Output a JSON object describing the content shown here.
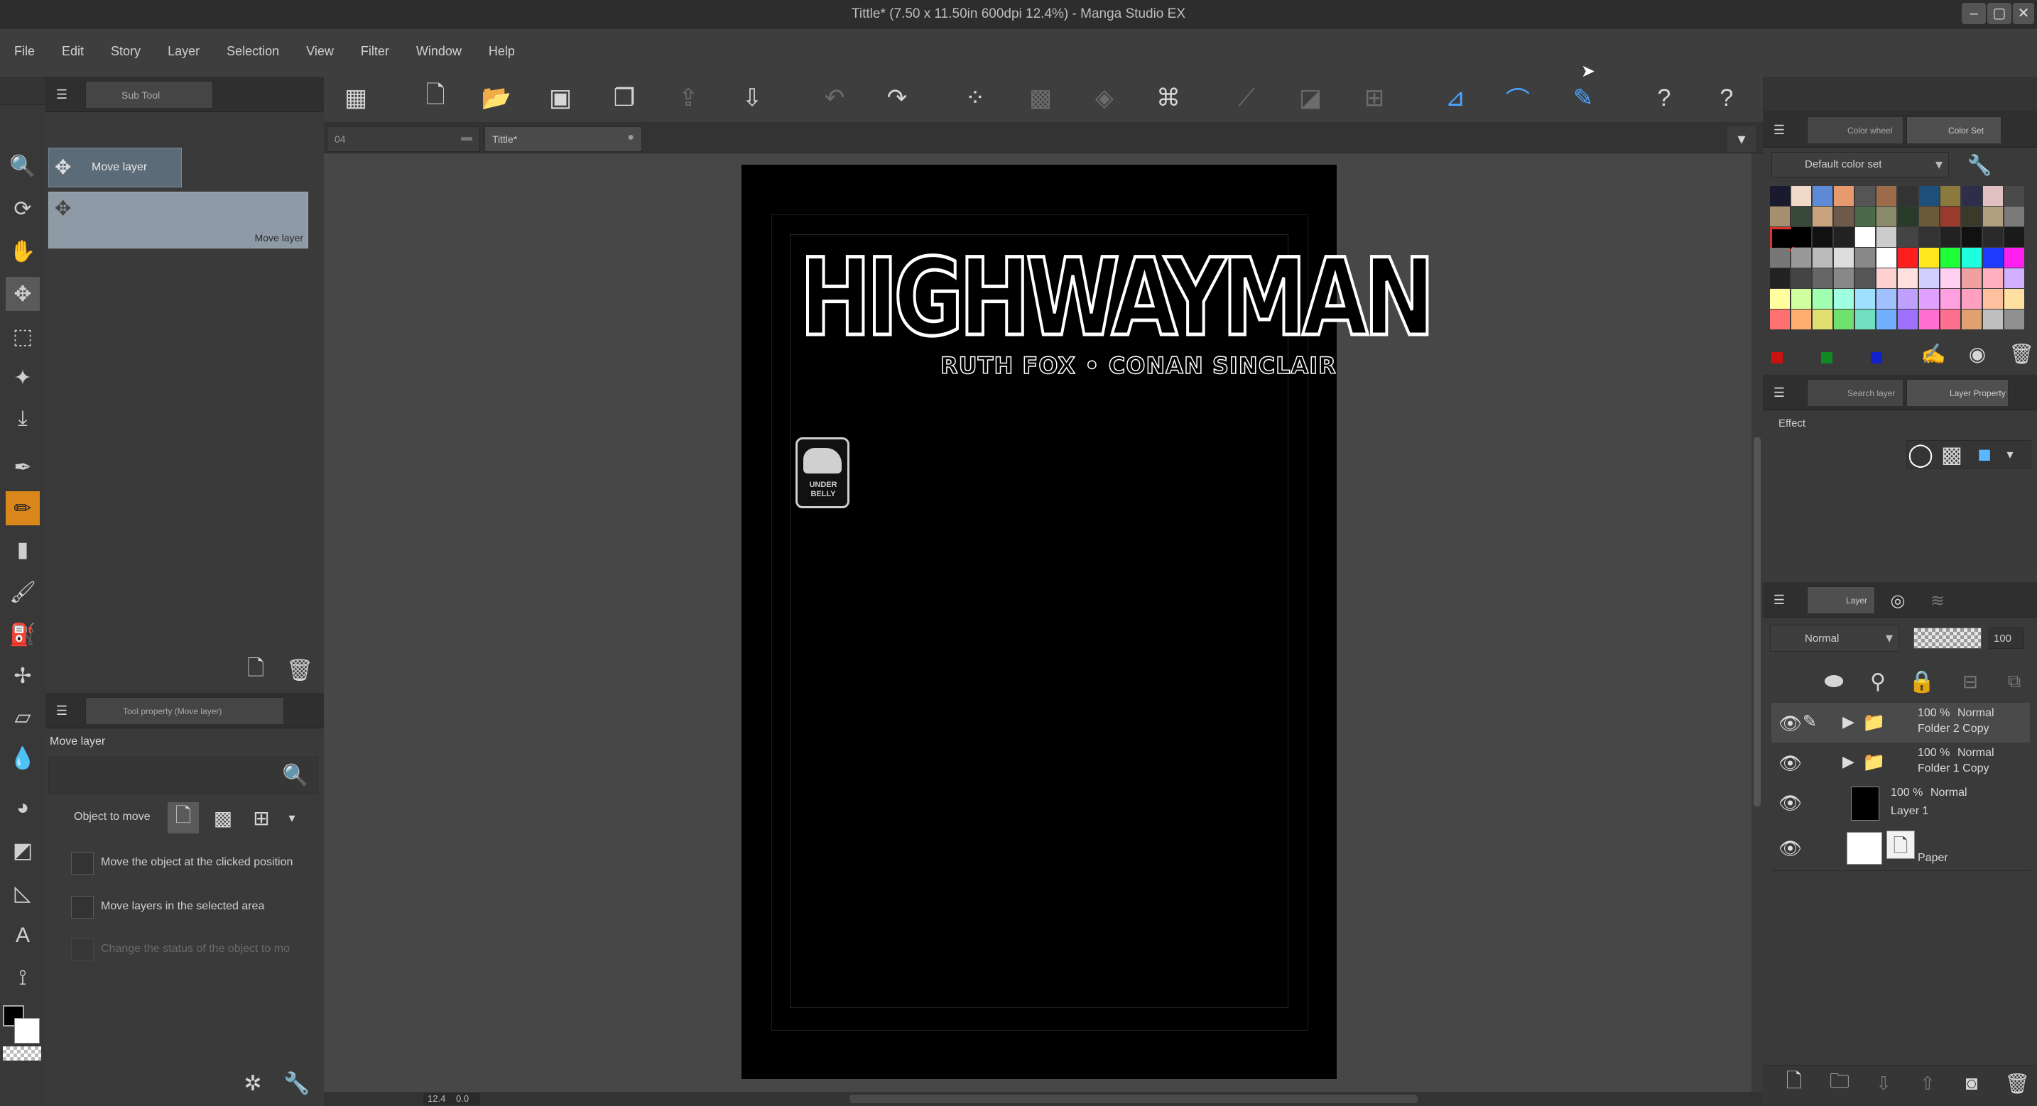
{
  "window": {
    "title": "Tittle* (7.50 x 11.50in 600dpi 12.4%) - Manga Studio EX"
  },
  "menu": [
    "File",
    "Edit",
    "Story",
    "Layer",
    "Selection",
    "View",
    "Filter",
    "Window",
    "Help"
  ],
  "toolbar": {
    "icons": [
      "grid-icon",
      "new-page-icon",
      "open-folder-icon",
      "save-icon",
      "page-icon",
      "export-icon",
      "import-icon",
      "undo-icon",
      "redo-icon",
      "transform-points-icon",
      "select-all-icon",
      "eraser-icon",
      "scale-icon",
      "diagonal-icon",
      "fill-icon",
      "grid-pattern-icon",
      "ruler-icon",
      "curve-icon",
      "pen-icon",
      "help-icon",
      "help-alt-icon"
    ]
  },
  "left_panel": {
    "subtool_tab": "Sub Tool",
    "subtool_items": [
      {
        "label": "Move layer"
      }
    ],
    "subtool_preview_label": "Move layer",
    "tool_property_tab": "Tool property (Move layer)",
    "tool_property_title": "Move layer",
    "object_to_move_label": "Object to move",
    "options": [
      {
        "label": "Move the object at the clicked position"
      },
      {
        "label": "Move layers in the selected area"
      },
      {
        "label": "Change the status of the object to mo"
      }
    ]
  },
  "document_tabs": [
    {
      "label": "04"
    },
    {
      "label": "Tittle*"
    }
  ],
  "canvas": {
    "title_text": "HIGHWAYMAN",
    "credits_text": "RUTH FOX • CONAN SINCLAIR",
    "badge_text": "UNDER BELLY",
    "zoom": "12.4",
    "angle": "0.0"
  },
  "colors": {
    "accent": "#4aa3ff",
    "tool_active": "#d9861a",
    "page": "#000000"
  },
  "color_panel": {
    "tab_color_wheel": "Color wheel",
    "tab_color_set": "Color Set",
    "color_set_name": "Default color set"
  },
  "layer_property": {
    "tab_search": "Search layer",
    "tab_property": "Layer Property",
    "effect_label": "Effect"
  },
  "layer_panel": {
    "tab": "Layer",
    "blend_mode": "Normal",
    "opacity": "100",
    "layers": [
      {
        "opacity": "100 %",
        "mode": "Normal",
        "name": "Folder 2 Copy"
      },
      {
        "opacity": "100 %",
        "mode": "Normal",
        "name": "Folder 1 Copy"
      },
      {
        "opacity": "100 %",
        "mode": "Normal",
        "name": "Layer 1"
      },
      {
        "name": "Paper"
      }
    ]
  }
}
